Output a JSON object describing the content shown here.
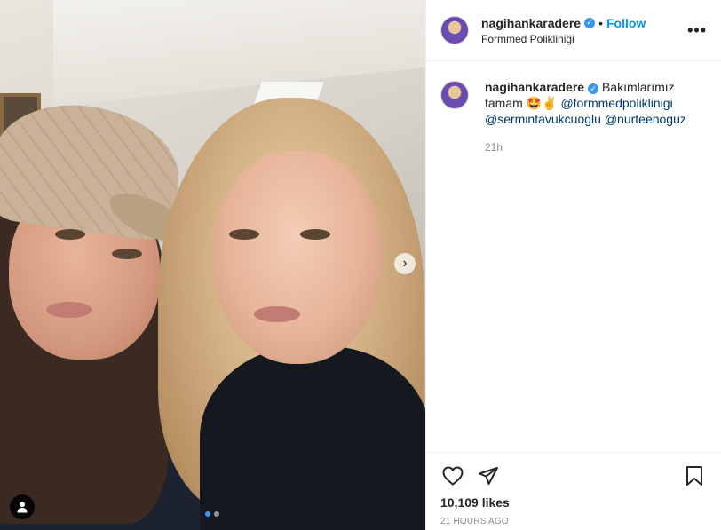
{
  "post": {
    "author": {
      "username": "nagihankaradere",
      "follow_label": "Follow",
      "separator": "•",
      "location": "Formmed Polikliniği",
      "more_label": "•••"
    },
    "caption": {
      "username": "nagihankaradere",
      "text_before": "Bakımlarımız tamam 🤩✌",
      "mentions": [
        "@formmedpoliklinigi",
        "@sermintavukcuoglu",
        "@nurteenoguz"
      ],
      "time": "21h"
    },
    "likes": "10,109 likes",
    "posted_ago": "21 HOURS AGO",
    "carousel": {
      "next_label": "›",
      "slides": 2,
      "active": 0
    }
  },
  "colors": {
    "accent": "#0095f6",
    "verified": "#3897f0",
    "mention": "#00376b",
    "muted": "#8e8e8e"
  },
  "icons": {
    "like": "heart-icon",
    "share": "paper-plane-icon",
    "save": "bookmark-icon",
    "tag": "user-tag-icon",
    "verified": "verified-badge-icon",
    "next": "chevron-right-icon"
  }
}
